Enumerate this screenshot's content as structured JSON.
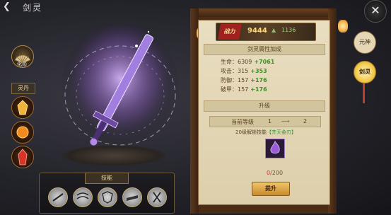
{
  "header": {
    "title": "剑灵"
  },
  "left_menu": {
    "huaxing_label": "化形",
    "dan_label": "灵丹"
  },
  "skills_panel": {
    "title": "技能",
    "slots": [
      "skill-1",
      "skill-2",
      "skill-3",
      "skill-4",
      "skill-5"
    ]
  },
  "power": {
    "label": "战力",
    "value": "9444",
    "increase": "1136"
  },
  "attributes": {
    "title": "剑灵属性加成",
    "rows": [
      {
        "name": "生命",
        "base": "6309",
        "bonus": "+7061"
      },
      {
        "name": "攻击",
        "base": "315",
        "bonus": "+353"
      },
      {
        "name": "防御",
        "base": "157",
        "bonus": "+176"
      },
      {
        "name": "破甲",
        "base": "157",
        "bonus": "+176"
      }
    ]
  },
  "upgrade": {
    "title": "升级",
    "level_label": "当前等级",
    "level_from": "1",
    "level_to": "2",
    "unlock_text": "20级解锁技能",
    "unlock_skill": "【齐天金刃】",
    "progress_current": "0",
    "progress_total": "/200",
    "button_label": "提升"
  },
  "tabs": {
    "yuanshen": "元神",
    "jianling": "剑灵"
  },
  "colors": {
    "accent": "#c78a2a",
    "bonus_green": "#3f8f27",
    "power_gold": "#ffdb7a"
  }
}
